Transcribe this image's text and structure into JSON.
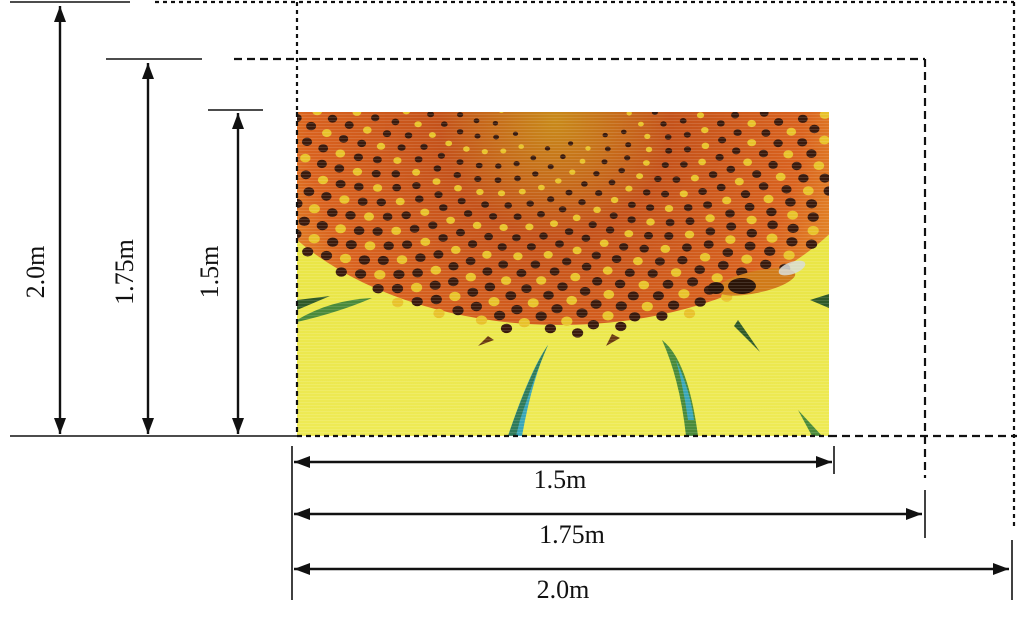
{
  "colors": {
    "ink": "#111111",
    "petal_yellow": "#e6e23a",
    "petal_light": "#f0ee6a",
    "disc_orange": "#d9621e",
    "disc_dark": "#3a1a0c",
    "disc_yellow": "#e8c22a",
    "leaf_green": "#4a8a3a",
    "leaf_blue": "#3aa6b8"
  },
  "photo": {
    "subject": "sunflower-closeup",
    "icon": "sunflower-photo"
  },
  "dimensions": {
    "vertical": [
      {
        "label": "2.0m"
      },
      {
        "label": "1.75m"
      },
      {
        "label": "1.5m"
      }
    ],
    "horizontal": [
      {
        "label": "1.5m"
      },
      {
        "label": "1.75m"
      },
      {
        "label": "2.0m"
      }
    ]
  }
}
